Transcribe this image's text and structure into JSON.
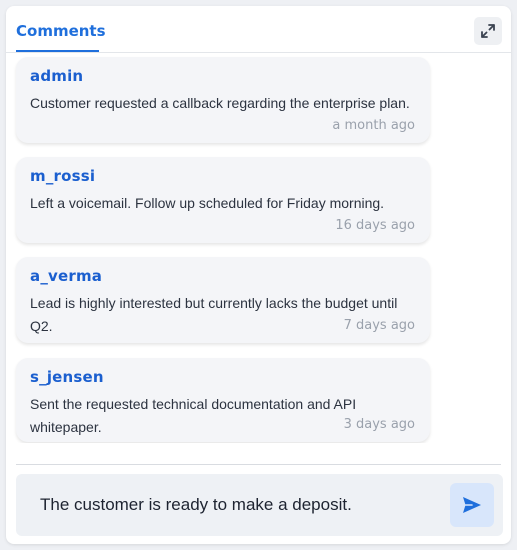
{
  "header": {
    "tab_label": "Comments",
    "expand_icon": "expand-arrows-icon"
  },
  "comments": [
    {
      "author": "admin",
      "text": "Customer requested a callback regarding the enterprise plan.",
      "time": "a month ago"
    },
    {
      "author": "m_rossi",
      "text": "Left a voicemail. Follow up scheduled for Friday morning.",
      "time": "16 days ago"
    },
    {
      "author": "a_verma",
      "text": "Lead is highly interested but currently lacks the budget until Q2.",
      "time": "7 days ago"
    },
    {
      "author": "s_jensen",
      "text": "Sent the requested technical documentation and API whitepaper.",
      "time": "3 days ago"
    }
  ],
  "composer": {
    "value": "The customer is ready to make a deposit.",
    "send_icon": "send-icon"
  },
  "colors": {
    "accent": "#1f6fdc",
    "author": "#1b5fcf",
    "card": "#f4f5f8",
    "muted": "#9aa1ac"
  }
}
